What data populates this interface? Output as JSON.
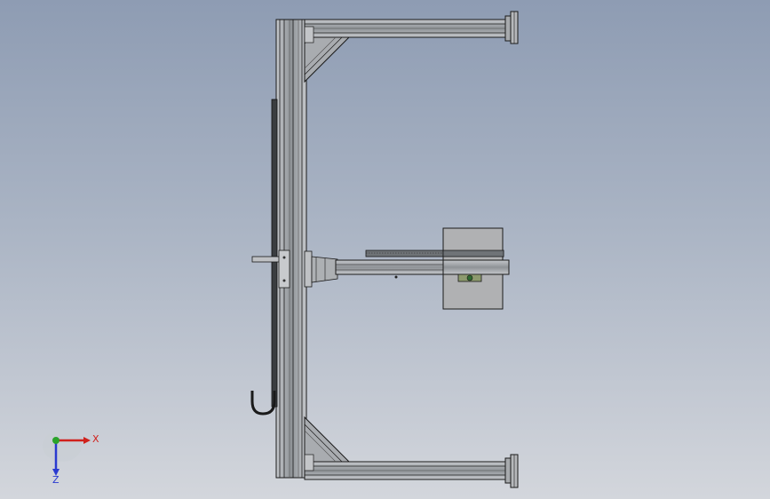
{
  "viewport": {
    "background_top": "#8e9cb3",
    "background_bottom": "#d3d6dc"
  },
  "triad": {
    "x_label": "X",
    "z_label": "Z",
    "x_color": "#d0211c",
    "y_color": "#2aa32a",
    "z_color": "#2a3ad0"
  },
  "model": {
    "frame_color": "#9ea2a6",
    "edge_color": "#1a1a1a",
    "panel_color": "#b0b1b3"
  }
}
